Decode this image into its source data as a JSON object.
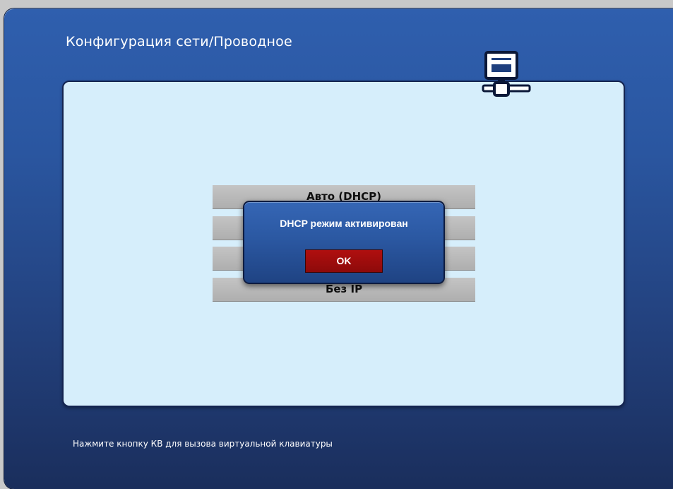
{
  "header": {
    "title": "Конфигурация сети/Проводное",
    "icon": "wired-network-icon"
  },
  "options": [
    {
      "label": "Авто (DHCP)"
    },
    {
      "label": ""
    },
    {
      "label": ""
    },
    {
      "label": "Без IP"
    }
  ],
  "dialog": {
    "message": "DHCP режим активирован",
    "ok_label": "OK"
  },
  "footer": {
    "hint": "Нажмите кнопку КВ для вызова виртуальной клавиатуры"
  },
  "colors": {
    "frame": "#2a56a0",
    "panel": "#d6eefb",
    "ok_button": "#a00d0d",
    "option": "#b8b8b8"
  }
}
